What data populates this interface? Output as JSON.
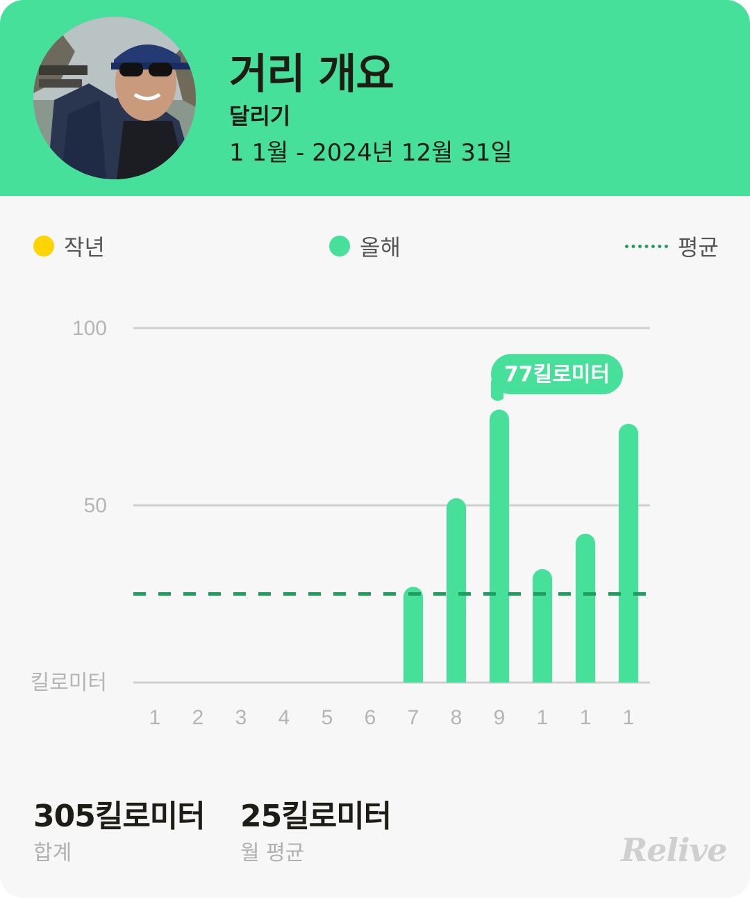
{
  "header": {
    "title": "거리 개요",
    "subtitle": "달리기",
    "date_range": "1 1월 - 2024년 12월 31일",
    "background_color": "#46e09b"
  },
  "legend": {
    "last_year": {
      "label": "작년",
      "color": "#ffd400"
    },
    "this_year": {
      "label": "올해",
      "color": "#46e09b"
    },
    "average": {
      "label": "평균",
      "color": "#1f9e5e"
    }
  },
  "chart_data": {
    "type": "bar",
    "categories": [
      "1",
      "2",
      "3",
      "4",
      "5",
      "6",
      "7",
      "8",
      "9",
      "1",
      "1",
      "1"
    ],
    "series": [
      {
        "name": "올해",
        "values": [
          0,
          0,
          0,
          0,
          0,
          0,
          27,
          52,
          77,
          32,
          42,
          73
        ]
      }
    ],
    "average": 25,
    "ylim": [
      0,
      100
    ],
    "yticks": [
      "100",
      "50",
      "킬로미터"
    ],
    "ytick_values": [
      100,
      50,
      0
    ],
    "highlight": {
      "category_index": 8,
      "label": "77킬로미터"
    },
    "grid": true,
    "legend_position": "top"
  },
  "stats": [
    {
      "value": "305킬로미터",
      "label": "합계"
    },
    {
      "value": "25킬로미터",
      "label": "월 평균"
    }
  ],
  "brand": "Relive"
}
